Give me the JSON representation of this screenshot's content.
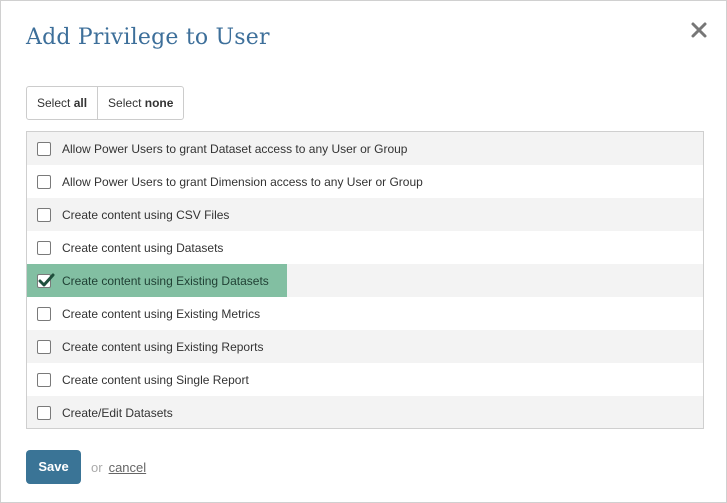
{
  "dialog": {
    "title": "Add Privilege to User",
    "close_icon": "close-icon"
  },
  "selection": {
    "select_prefix": "Select",
    "all_label": "all",
    "none_label": "none"
  },
  "privileges": [
    {
      "label": "Allow Power Users to grant Dataset access to any User or Group",
      "checked": false
    },
    {
      "label": "Allow Power Users to grant Dimension access to any User or Group",
      "checked": false
    },
    {
      "label": "Create content using CSV Files",
      "checked": false
    },
    {
      "label": "Create content using Datasets",
      "checked": false
    },
    {
      "label": "Create content using Existing Datasets",
      "checked": true
    },
    {
      "label": "Create content using Existing Metrics",
      "checked": false
    },
    {
      "label": "Create content using Existing Reports",
      "checked": false
    },
    {
      "label": "Create content using Single Report",
      "checked": false
    },
    {
      "label": "Create/Edit Datasets",
      "checked": false
    }
  ],
  "footer": {
    "save_label": "Save",
    "or_label": "or",
    "cancel_label": "cancel"
  },
  "colors": {
    "title": "#3d6f9a",
    "save_button": "#3a7496",
    "highlight": "#82bfa2",
    "check": "#1f4f3c"
  }
}
